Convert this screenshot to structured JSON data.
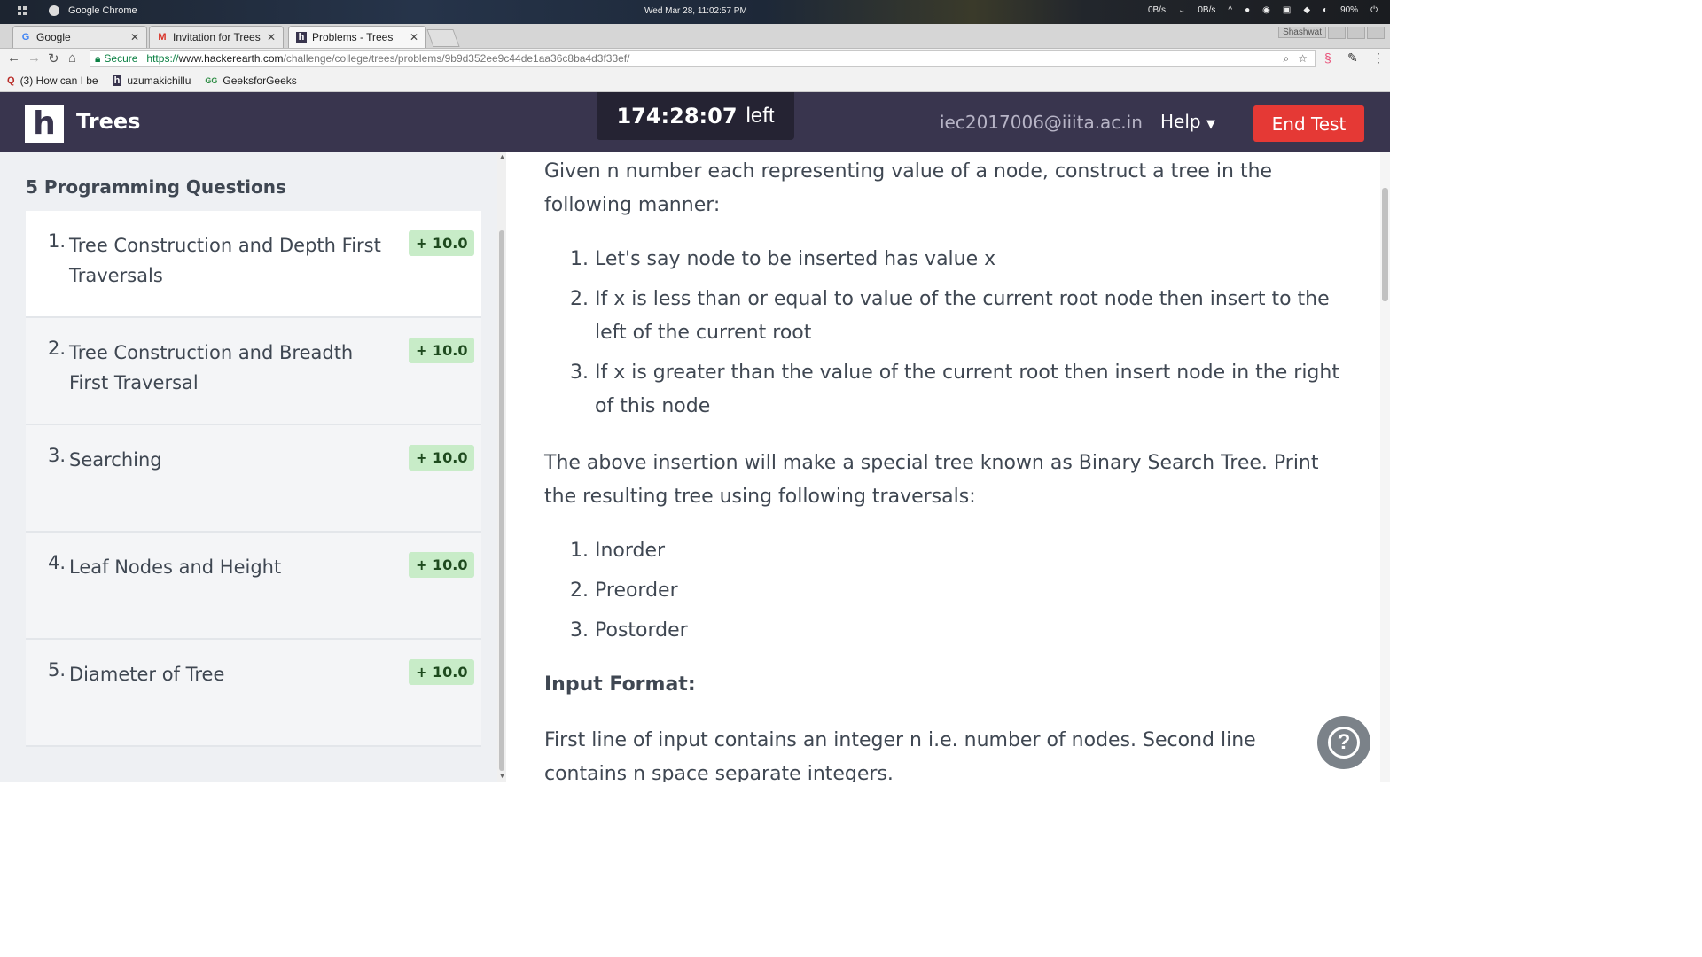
{
  "os": {
    "app_name": "Google Chrome",
    "clock": "Wed Mar 28, 11:02:57 PM",
    "net_down": "0B/s",
    "net_up": "0B/s",
    "battery": "90%"
  },
  "browser": {
    "tabs": [
      {
        "favicon": "G",
        "title": "Google"
      },
      {
        "favicon": "M",
        "title": "Invitation for Trees t"
      },
      {
        "favicon": "h",
        "title": "Problems - Trees"
      }
    ],
    "user": "Shashwat",
    "secure_label": "Secure",
    "url_scheme": "https://",
    "url_host": "www.hackerearth.com",
    "url_path": "/challenge/college/trees/problems/9b9d352ee9c44de1aa36c8ba4d3f33ef/",
    "bookmarks": [
      {
        "icon": "Q",
        "label": "(3) How can I be"
      },
      {
        "icon": "h",
        "label": "uzumakichillu"
      },
      {
        "icon": "GG",
        "label": "GeeksforGeeks"
      }
    ]
  },
  "header": {
    "logo_letter": "h",
    "title": "Trees",
    "timer": "174:28:07",
    "timer_suffix": "left",
    "email": "iec2017006@iiita.ac.in",
    "help_label": "Help",
    "end_test_label": "End Test"
  },
  "sidebar": {
    "heading": "5 Programming Questions",
    "questions": [
      {
        "num": "1.",
        "title": "Tree Construction and Depth First Traversals",
        "score": "+ 10.0"
      },
      {
        "num": "2.",
        "title": "Tree Construction and Breadth First Traversal",
        "score": "+ 10.0"
      },
      {
        "num": "3.",
        "title": "Searching",
        "score": "+ 10.0"
      },
      {
        "num": "4.",
        "title": "Leaf Nodes and Height",
        "score": "+ 10.0"
      },
      {
        "num": "5.",
        "title": "Diameter of Tree",
        "score": "+ 10.0"
      }
    ]
  },
  "problem": {
    "intro": "Given n number each representing value of a node, construct a tree in the following manner:",
    "rules": [
      "Let's say node to be inserted has value x",
      "If x is less than or equal to value of the current root node then  insert to the left of the current root",
      "If x is greater than the value of the current root then insert node in the right of this node"
    ],
    "middle": "The above insertion will make a special tree known as Binary Search Tree. Print the resulting tree using following traversals:",
    "traversals": [
      "Inorder",
      "Preorder",
      "Postorder"
    ],
    "input_heading": "Input Format:",
    "input_text": "First line of input contains an integer n i.e. number of nodes. Second line contains n space separate integers."
  },
  "help_fab_label": "?"
}
